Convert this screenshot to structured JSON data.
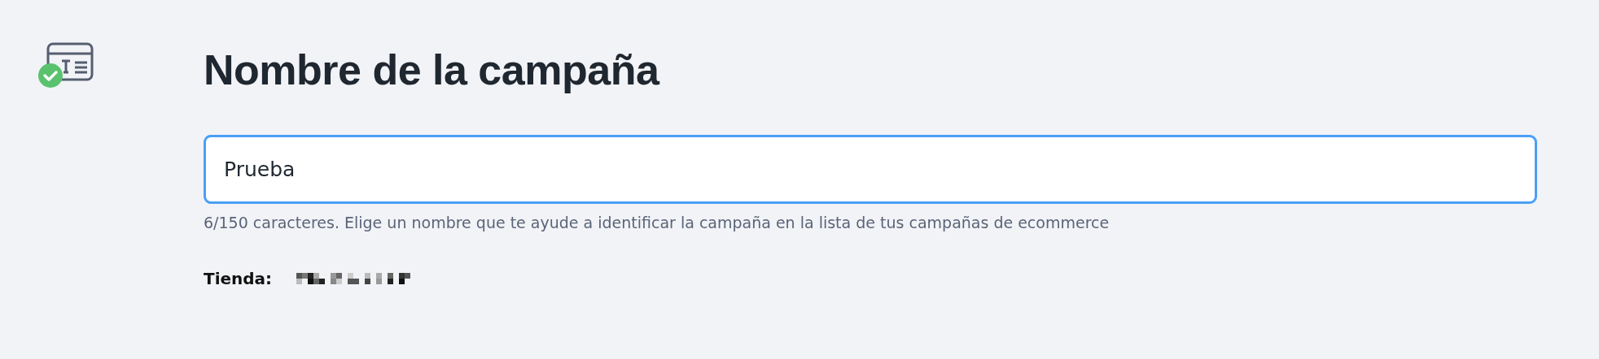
{
  "title": "Nombre de la campaña",
  "name_field": {
    "value": "Prueba",
    "focused": true,
    "helper": "6/150 caracteres. Elige un nombre que te ayude a identificar la campaña en la lista de tus campañas de ecommerce"
  },
  "store": {
    "label": "Tienda:"
  }
}
